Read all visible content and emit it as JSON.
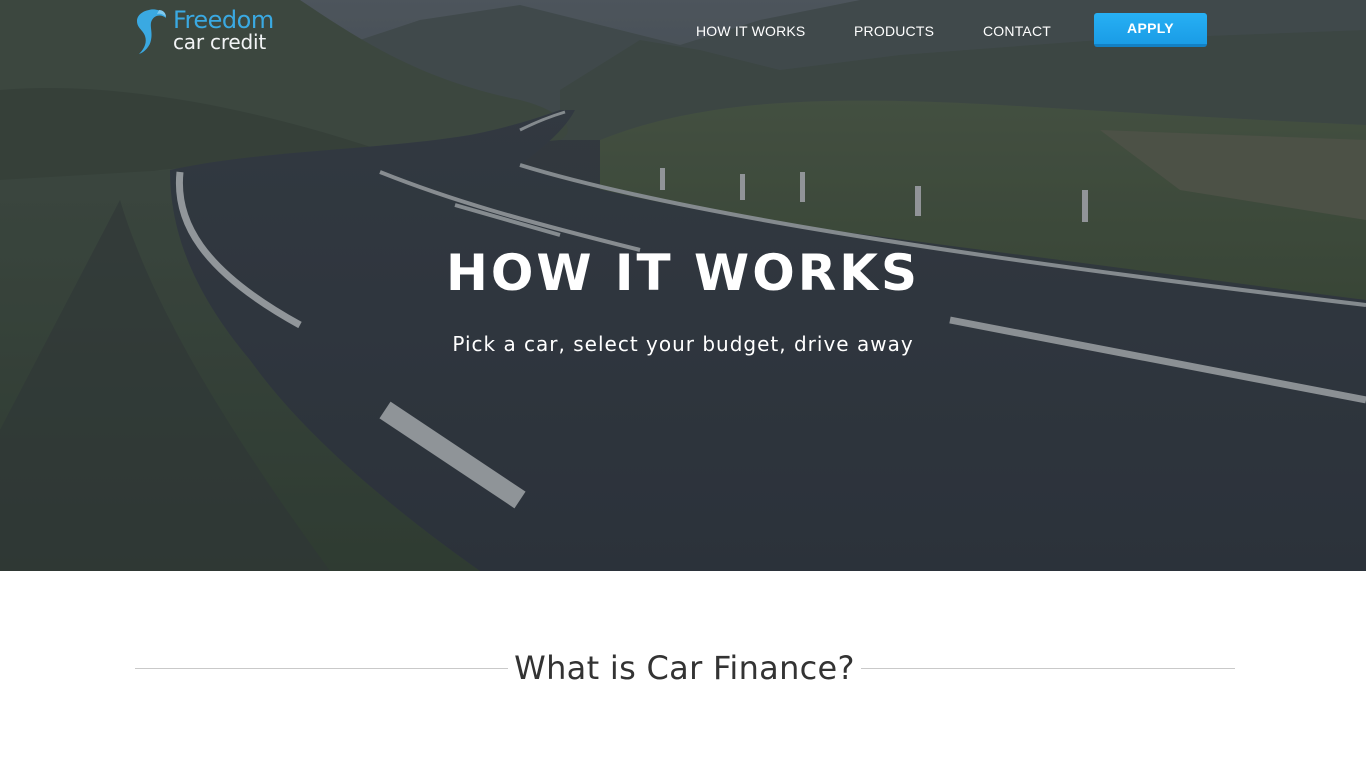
{
  "brand": {
    "name_line1": "Freedom",
    "name_line2": "car credit",
    "accent_color": "#3aa9e2",
    "logo_icon": "swoosh-mark-icon"
  },
  "nav": {
    "items": [
      {
        "label": "HOW IT WORKS"
      },
      {
        "label": "PRODUCTS"
      },
      {
        "label": "CONTACT"
      }
    ],
    "apply_label": "APPLY",
    "apply_color": "#1fa3ea"
  },
  "hero": {
    "title": "HOW IT WORKS",
    "subtitle": "Pick a car, select your budget, drive away"
  },
  "section": {
    "heading": "What is Car Finance?"
  }
}
